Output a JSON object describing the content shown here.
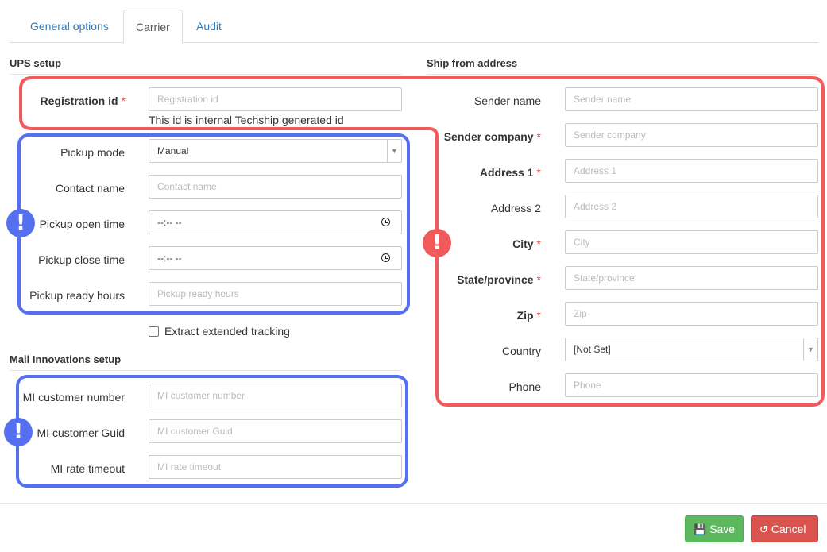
{
  "tabs": [
    {
      "label": "General options",
      "active": false
    },
    {
      "label": "Carrier",
      "active": true
    },
    {
      "label": "Audit",
      "active": false
    }
  ],
  "ups": {
    "title": "UPS setup",
    "registration": {
      "label": "Registration id",
      "placeholder": "Registration id",
      "help": "This id is internal Techship generated id"
    },
    "pickup_mode": {
      "label": "Pickup mode",
      "value": "Manual"
    },
    "contact_name": {
      "label": "Contact name",
      "placeholder": "Contact name"
    },
    "pickup_open": {
      "label": "Pickup open time",
      "value": "--:-- --"
    },
    "pickup_close": {
      "label": "Pickup close time",
      "value": "--:-- --"
    },
    "pickup_ready": {
      "label": "Pickup ready hours",
      "placeholder": "Pickup ready hours"
    },
    "extended_tracking": {
      "label": "Extract extended tracking",
      "checked": false
    }
  },
  "mi": {
    "title": "Mail Innovations setup",
    "customer_number": {
      "label": "MI customer number",
      "placeholder": "MI customer number"
    },
    "customer_guid": {
      "label": "MI customer Guid",
      "placeholder": "MI customer Guid"
    },
    "rate_timeout": {
      "label": "MI rate timeout",
      "placeholder": "MI rate timeout"
    }
  },
  "ship_from": {
    "title": "Ship from address",
    "sender_name": {
      "label": "Sender name",
      "placeholder": "Sender name"
    },
    "sender_company": {
      "label": "Sender company",
      "placeholder": "Sender company"
    },
    "address1": {
      "label": "Address 1",
      "placeholder": "Address 1"
    },
    "address2": {
      "label": "Address 2",
      "placeholder": "Address 2"
    },
    "city": {
      "label": "City",
      "placeholder": "City"
    },
    "state": {
      "label": "State/province",
      "placeholder": "State/province"
    },
    "zip": {
      "label": "Zip",
      "placeholder": "Zip"
    },
    "country": {
      "label": "Country",
      "value": "[Not Set]"
    },
    "phone": {
      "label": "Phone",
      "placeholder": "Phone"
    }
  },
  "required_mark": "*",
  "alert_mark": "!",
  "buttons": {
    "save": "Save",
    "cancel": "Cancel"
  },
  "colors": {
    "highlight_blue": "#5470f0",
    "highlight_red": "#f05a5a",
    "save": "#5cb85c",
    "cancel": "#d9534f",
    "link": "#337ab7"
  }
}
